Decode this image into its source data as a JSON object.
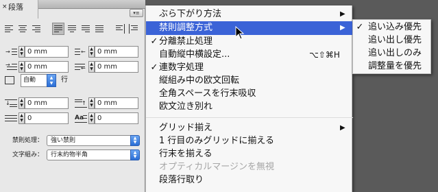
{
  "panel": {
    "title": "段落",
    "close_icon": "×",
    "menu_button_icon": "▾≡",
    "fields": {
      "left_indent": "0 mm",
      "right_indent": "0 mm",
      "first_line_indent": "0 mm",
      "last_line_indent": "0 mm",
      "space_before": "0 mm",
      "space_after": "0 mm",
      "drop_cap_lines": "0",
      "drop_cap_chars": "0"
    },
    "leading": {
      "value": "自動",
      "suffix": "行"
    },
    "kinsoku": {
      "label": "禁則処理：",
      "value": "強い禁則"
    },
    "mojikumi": {
      "label": "文字組み：",
      "value": "行末約物半角"
    }
  },
  "menu": {
    "items": [
      {
        "label": "ぶら下がり方法",
        "check": "",
        "shortcut": "",
        "submenu": "▶",
        "state": "normal"
      },
      {
        "label": "禁則調整方式",
        "check": "",
        "shortcut": "",
        "submenu": "▶",
        "state": "highlighted"
      },
      {
        "label": "分離禁止処理",
        "check": "✓",
        "shortcut": "",
        "submenu": "",
        "state": "normal"
      },
      {
        "label": "自動縦中横設定...",
        "check": "",
        "shortcut": "⌥⇧⌘H",
        "submenu": "",
        "state": "normal"
      },
      {
        "label": "連数字処理",
        "check": "✓",
        "shortcut": "",
        "submenu": "",
        "state": "normal"
      },
      {
        "label": "縦組み中の欧文回転",
        "check": "",
        "shortcut": "",
        "submenu": "",
        "state": "normal"
      },
      {
        "label": "全角スペースを行末吸収",
        "check": "",
        "shortcut": "",
        "submenu": "",
        "state": "normal"
      },
      {
        "label": "欧文泣き別れ",
        "check": "",
        "shortcut": "",
        "submenu": "",
        "state": "normal"
      },
      {
        "label": "グリッド揃え",
        "check": "",
        "shortcut": "",
        "submenu": "▶",
        "state": "normal"
      },
      {
        "label": "1 行目のみグリッドに揃える",
        "check": "",
        "shortcut": "",
        "submenu": "",
        "state": "normal"
      },
      {
        "label": "行末を揃える",
        "check": "",
        "shortcut": "",
        "submenu": "",
        "state": "normal"
      },
      {
        "label": "オプティカルマージンを無視",
        "check": "",
        "shortcut": "",
        "submenu": "",
        "state": "disabled"
      },
      {
        "label": "段落行取り",
        "check": "",
        "shortcut": "",
        "submenu": "",
        "state": "normal"
      }
    ]
  },
  "submenu": {
    "items": [
      {
        "label": "追い込み優先",
        "check": "✓"
      },
      {
        "label": "追い出し優先",
        "check": ""
      },
      {
        "label": "追い出しのみ",
        "check": ""
      },
      {
        "label": "調整量を優先",
        "check": ""
      }
    ]
  },
  "colors": {
    "highlight": "#3b63d7",
    "stepper_blue": "#2b6ed6",
    "panel_bg": "#e8e8e8",
    "backdrop": "#5a5a5a"
  },
  "icons": {
    "cursor": "arrow-cursor-icon",
    "submenu": "chevron-right-icon",
    "check": "checkmark-icon"
  }
}
